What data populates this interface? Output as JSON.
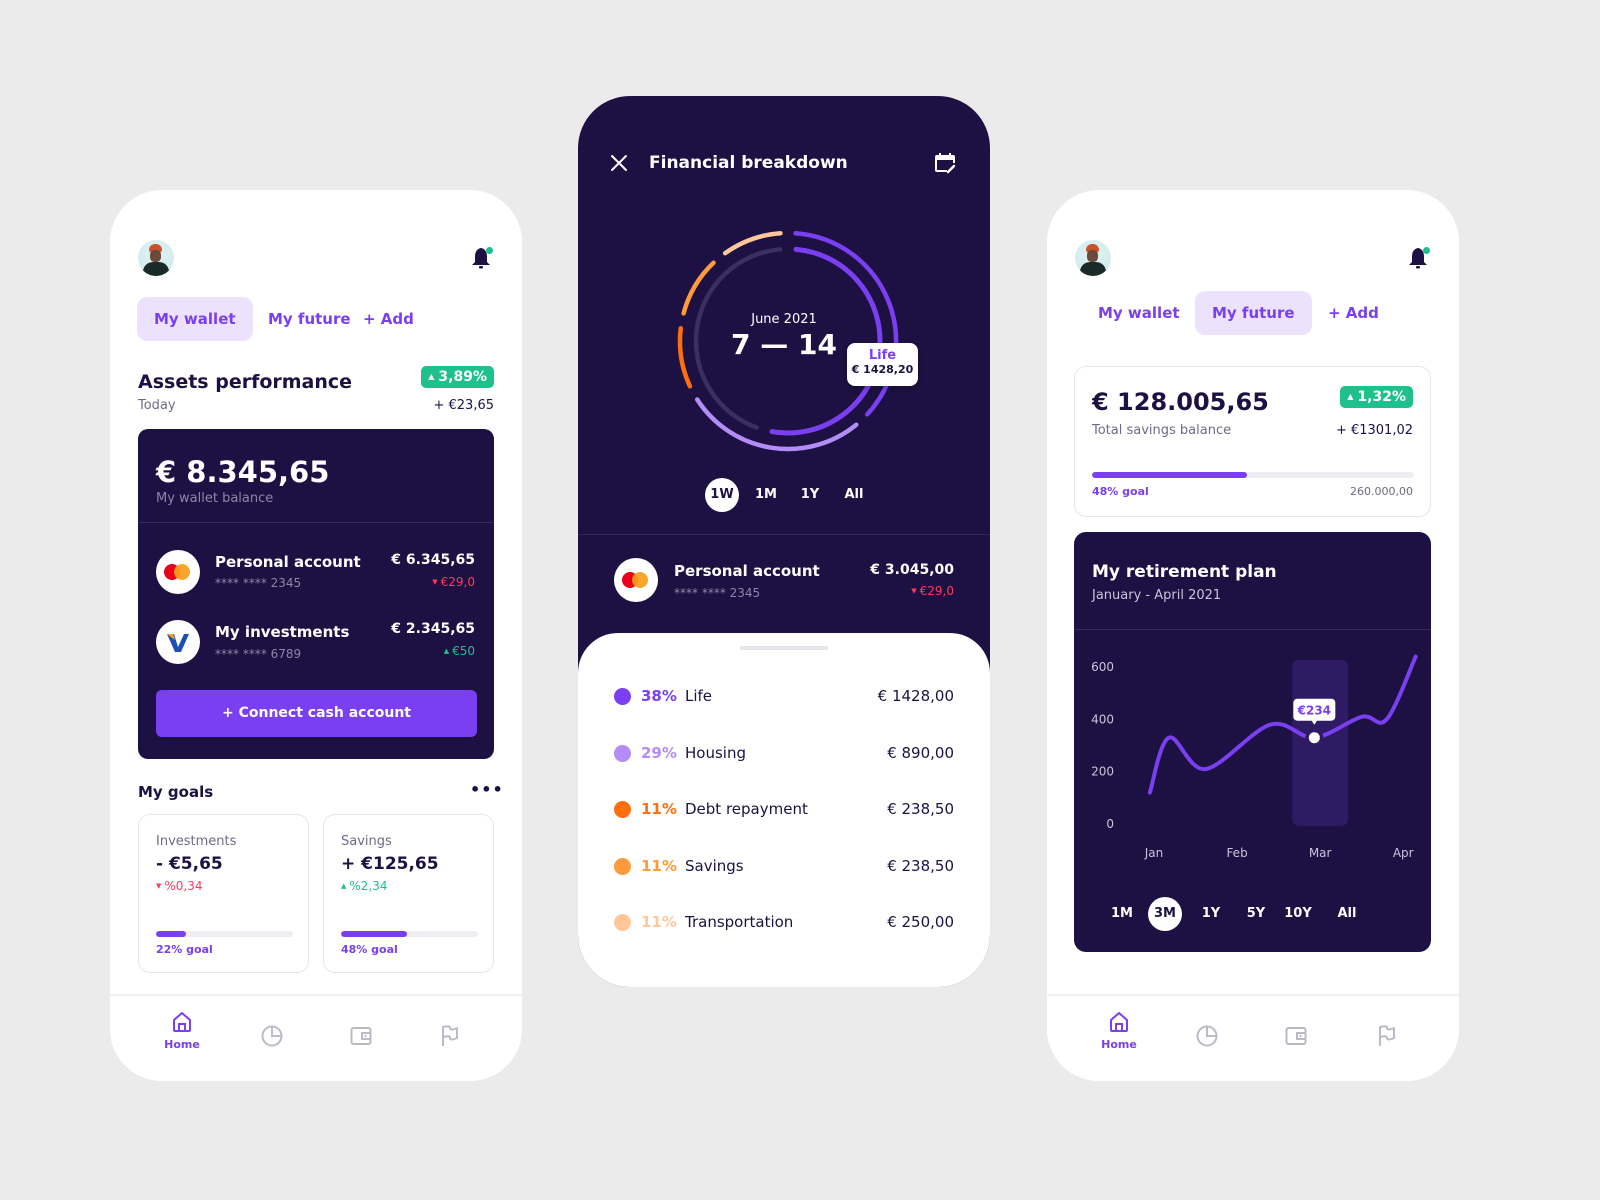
{
  "screens": {
    "wallet": {
      "tabs": [
        {
          "label": "My wallet",
          "active": true
        },
        {
          "label": "My future",
          "active": false
        },
        {
          "label": "+ Add",
          "active": false
        }
      ],
      "assets": {
        "title": "Assets performance",
        "subtitle": "Today",
        "change_pct": "3,89%",
        "change_amount": "+ €23,65"
      },
      "balance_card": {
        "balance": "€ 8.345,65",
        "balance_label": "My wallet balance",
        "accounts": [
          {
            "name": "Personal account",
            "number": "**** **** 2345",
            "amount": "€ 6.345,65",
            "delta": "€29,0",
            "delta_dir": "down",
            "logo": "mastercard-icon"
          },
          {
            "name": "My investments",
            "number": "**** **** 6789",
            "amount": "€ 2.345,65",
            "delta": "€50",
            "delta_dir": "up",
            "logo": "visa-icon"
          }
        ],
        "connect_button": "+ Connect cash account"
      },
      "goals": {
        "title": "My goals",
        "items": [
          {
            "label": "Investments",
            "value": "- €5,65",
            "delta": "%0,34",
            "delta_dir": "down",
            "progress": 0.22,
            "progress_label": "22% goal"
          },
          {
            "label": "Savings",
            "value": "+ €125,65",
            "delta": "%2,34",
            "delta_dir": "up",
            "progress": 0.48,
            "progress_label": "48% goal"
          }
        ]
      },
      "nav": [
        {
          "label": "Home",
          "icon": "home-icon",
          "active": true
        },
        {
          "label": "",
          "icon": "pie-chart-icon",
          "active": false
        },
        {
          "label": "",
          "icon": "wallet-icon",
          "active": false
        },
        {
          "label": "",
          "icon": "flag-icon",
          "active": false
        }
      ]
    },
    "breakdown": {
      "title": "Financial breakdown",
      "period_month": "June 2021",
      "period_range": "7 — 14",
      "tooltip": {
        "label": "Life",
        "value": "€ 1428,20"
      },
      "ranges": [
        {
          "label": "1W",
          "active": true
        },
        {
          "label": "1M",
          "active": false
        },
        {
          "label": "1Y",
          "active": false
        },
        {
          "label": "All",
          "active": false
        }
      ],
      "account": {
        "name": "Personal account",
        "number": "**** **** 2345",
        "amount": "€ 3.045,00",
        "delta": "€29,0",
        "delta_dir": "down"
      },
      "categories": [
        {
          "pct": "38%",
          "name": "Life",
          "amount": "€ 1428,00",
          "color": "#7b3ff2"
        },
        {
          "pct": "29%",
          "name": "Housing",
          "amount": "€ 890,00",
          "color": "#b38cf7"
        },
        {
          "pct": "11%",
          "name": "Debt repayment",
          "amount": "€ 238,50",
          "color": "#ff6f0f"
        },
        {
          "pct": "11%",
          "name": "Savings",
          "amount": "€ 238,50",
          "color": "#ff9a3d"
        },
        {
          "pct": "11%",
          "name": "Transportation",
          "amount": "€ 250,00",
          "color": "#ffc79a"
        }
      ]
    },
    "future": {
      "tabs": [
        {
          "label": "My wallet",
          "active": false
        },
        {
          "label": "My future",
          "active": true
        },
        {
          "label": "+ Add",
          "active": false
        }
      ],
      "savings": {
        "balance": "€ 128.005,65",
        "label": "Total savings balance",
        "change_pct": "1,32%",
        "change_amount": "+ €1301,02",
        "progress": 0.48,
        "progress_label": "48% goal",
        "target": "260.000,00"
      },
      "retirement": {
        "title": "My retirement plan",
        "subtitle": "January - April 2021",
        "ranges": [
          {
            "label": "1M",
            "active": false
          },
          {
            "label": "3M",
            "active": true
          },
          {
            "label": "1Y",
            "active": false
          },
          {
            "label": "5Y",
            "active": false
          },
          {
            "label": "10Y",
            "active": false
          },
          {
            "label": "All",
            "active": false
          }
        ]
      },
      "nav": [
        {
          "label": "Home",
          "icon": "home-icon",
          "active": true
        },
        {
          "label": "",
          "icon": "pie-chart-icon",
          "active": false
        },
        {
          "label": "",
          "icon": "wallet-icon",
          "active": false
        },
        {
          "label": "",
          "icon": "flag-icon",
          "active": false
        }
      ]
    }
  },
  "colors": {
    "primary": "#7b3ff2",
    "dark": "#1c1142",
    "positive": "#1ec08c",
    "negative": "#ff3a5c",
    "tab_active_bg": "#ece2fd"
  },
  "chart_data": [
    {
      "type": "line",
      "title": "My retirement plan",
      "subtitle": "January - April 2021",
      "categories": [
        "Jan",
        "Feb",
        "Mar",
        "Apr"
      ],
      "x": [
        0.0,
        0.3,
        0.6,
        0.9,
        1.2,
        1.5,
        1.8,
        2.1,
        2.4,
        2.7,
        3.0,
        3.2
      ],
      "series": [
        {
          "name": "Retirement plan",
          "values": [
            120,
            330,
            210,
            380,
            315,
            390,
            400,
            640
          ]
        }
      ],
      "points": [
        {
          "x": -0.05,
          "y": 120
        },
        {
          "x": 0.18,
          "y": 330
        },
        {
          "x": 0.62,
          "y": 210
        },
        {
          "x": 1.4,
          "y": 380
        },
        {
          "x": 1.93,
          "y": 330
        },
        {
          "x": 2.5,
          "y": 410
        },
        {
          "x": 2.8,
          "y": 400
        },
        {
          "x": 3.15,
          "y": 640
        }
      ],
      "highlight": {
        "category": "Mar",
        "label": "€234"
      },
      "yticks": [
        0,
        200,
        400,
        600
      ],
      "ylim": [
        0,
        650
      ],
      "grid": false,
      "xlabel": "",
      "ylabel": ""
    },
    {
      "type": "pie",
      "title": "Financial breakdown",
      "subtitle": "June 2021 7 — 14",
      "categories": [
        "Life",
        "Housing",
        "Debt repayment",
        "Savings",
        "Transportation"
      ],
      "values": [
        38,
        29,
        11,
        11,
        11
      ],
      "amounts": [
        1428.0,
        890.0,
        238.5,
        238.5,
        250.0
      ],
      "colors": [
        "#7b3ff2",
        "#b38cf7",
        "#ff6f0f",
        "#ff9a3d",
        "#ffc79a"
      ]
    }
  ]
}
